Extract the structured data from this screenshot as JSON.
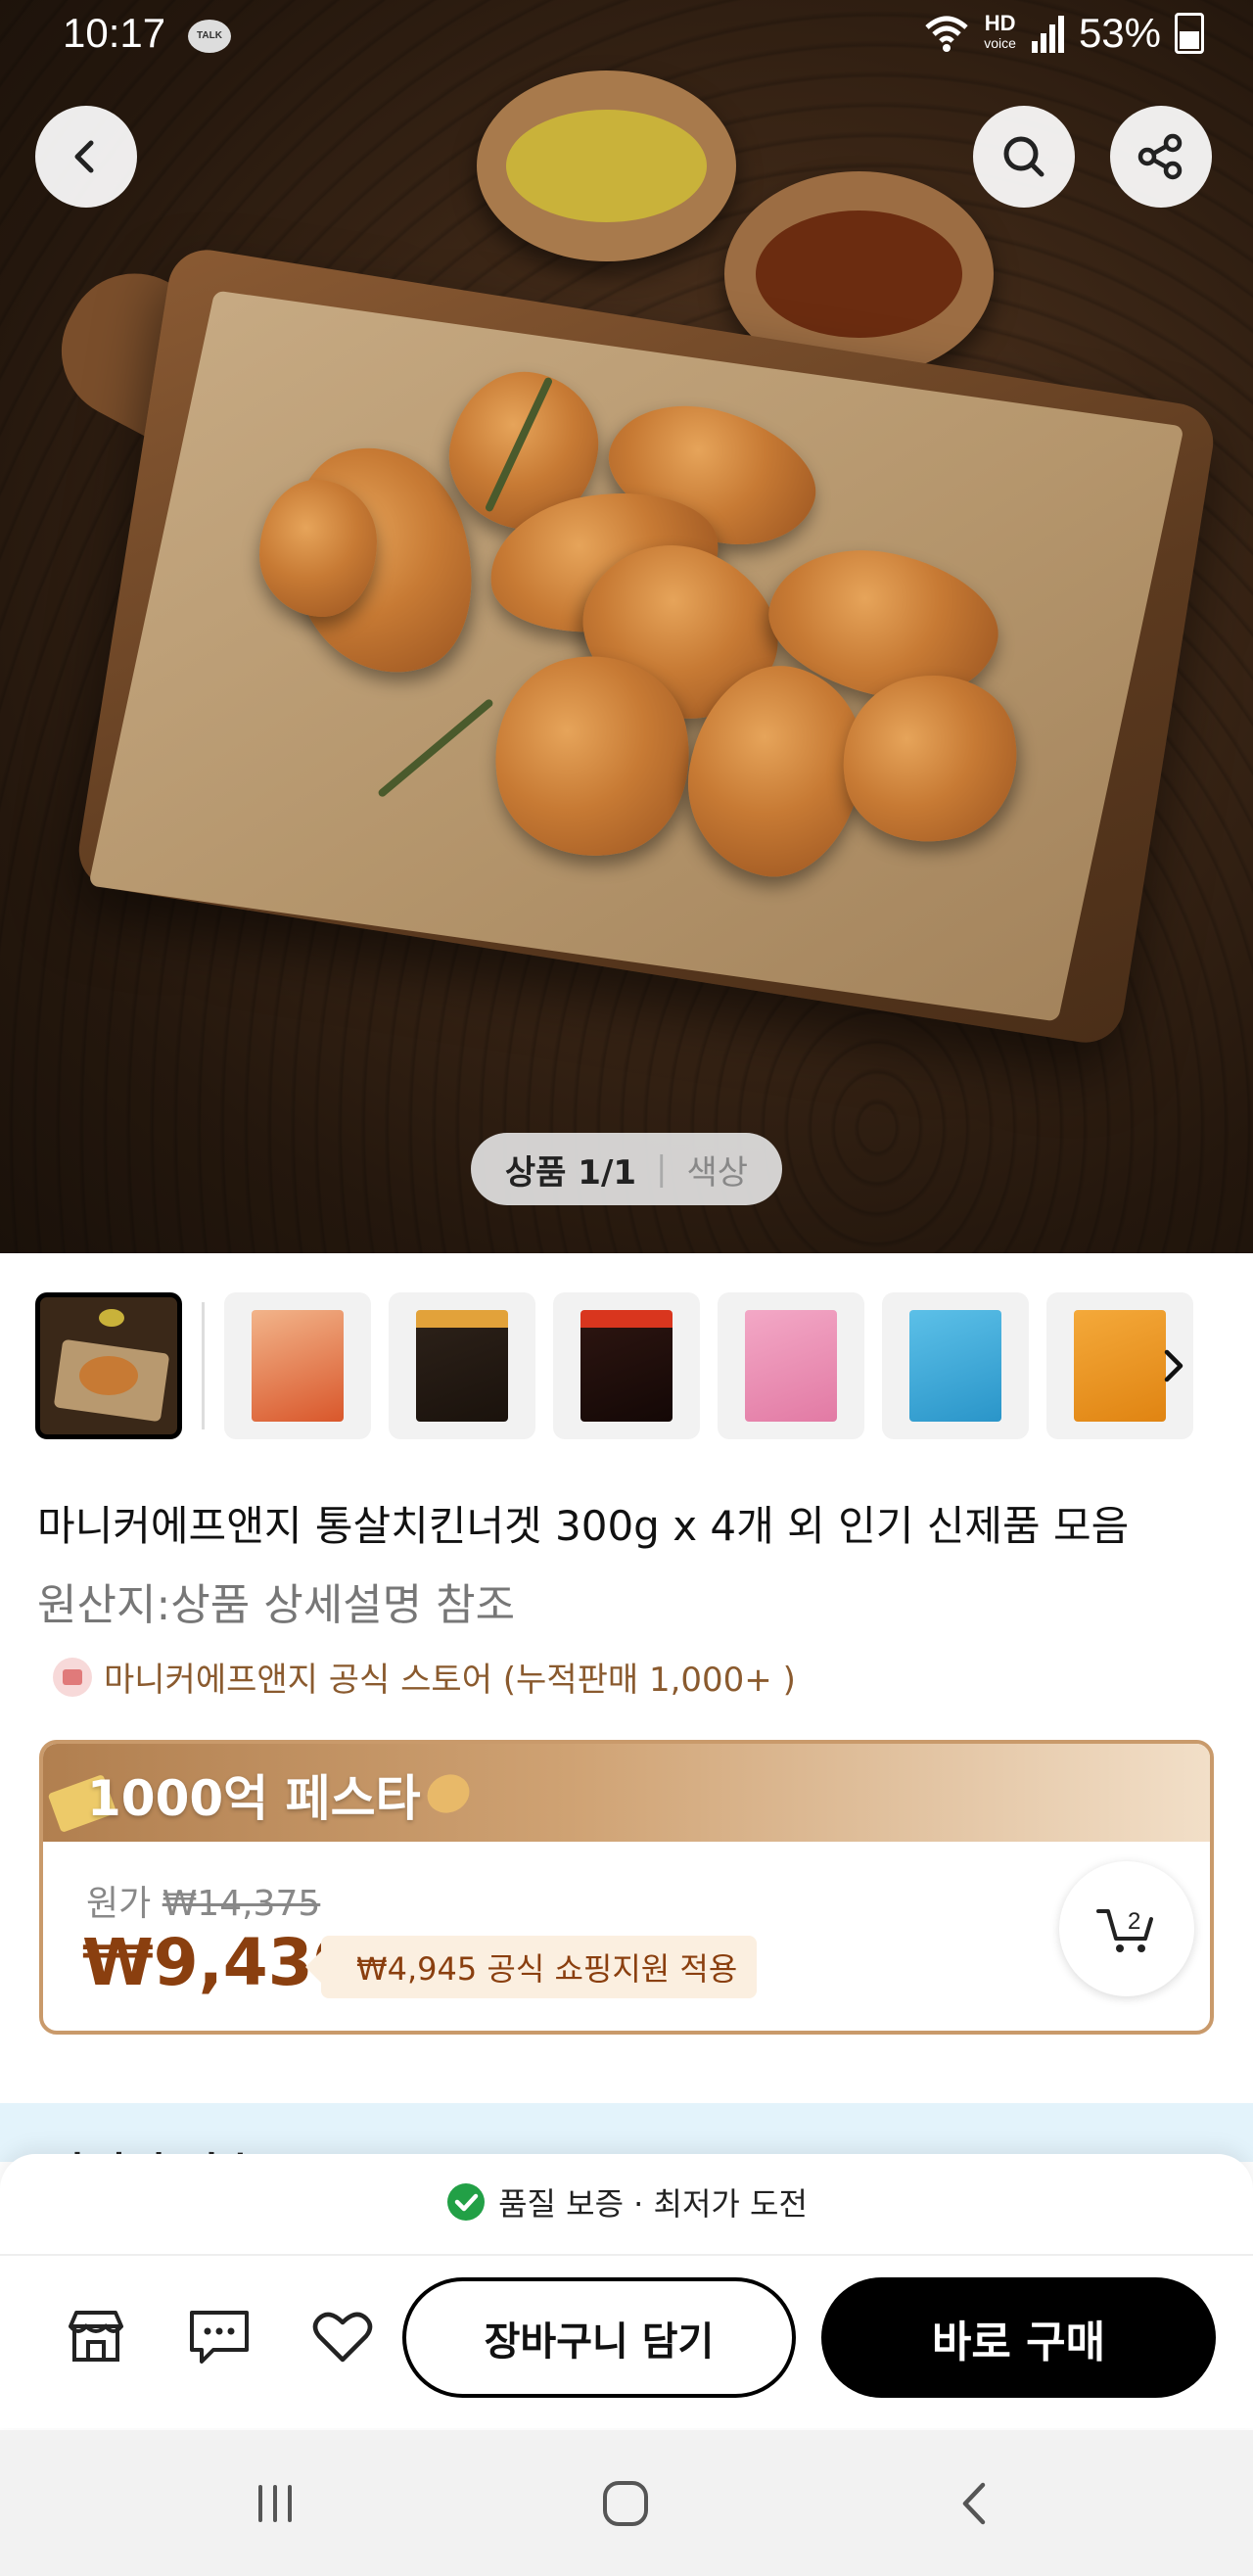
{
  "status_bar": {
    "time": "10:17",
    "talk_icon_label": "TALK",
    "network": "HD",
    "network_sub": "voice",
    "battery": "53%"
  },
  "hero": {
    "counter_current": "상품 1/1",
    "counter_separator": "|",
    "counter_alt": "색상",
    "back_icon": "back-arrow-icon",
    "search_icon": "search-icon",
    "share_icon": "share-icon"
  },
  "thumbnails": {
    "count_visible": 7
  },
  "product": {
    "title": "마니커에프앤지 통살치킨너겟 300g x 4개 외 인기 신제품 모음",
    "origin": "원산지:상품 상세설명 참조",
    "store": "마니커에프앤지 공식 스토어 (누적판매 1,000+ )"
  },
  "promo": {
    "title": "1000억 페스타",
    "original_label": "원가",
    "original_price": "₩14,375",
    "sale_price": "₩9,430",
    "coupon": "₩4,945 공식 쇼핑지원 적용",
    "cart_count": "2"
  },
  "bottom_bar": {
    "guarantee": "품질 보증 · 최저가 도전",
    "add_to_cart": "장바구니 담기",
    "buy_now": "바로 구매",
    "peek_text": "마니커 약속"
  },
  "colors": {
    "accent": "#8a3f0f",
    "promo_border": "#c99a6b",
    "guarantee_check": "#22a046"
  }
}
